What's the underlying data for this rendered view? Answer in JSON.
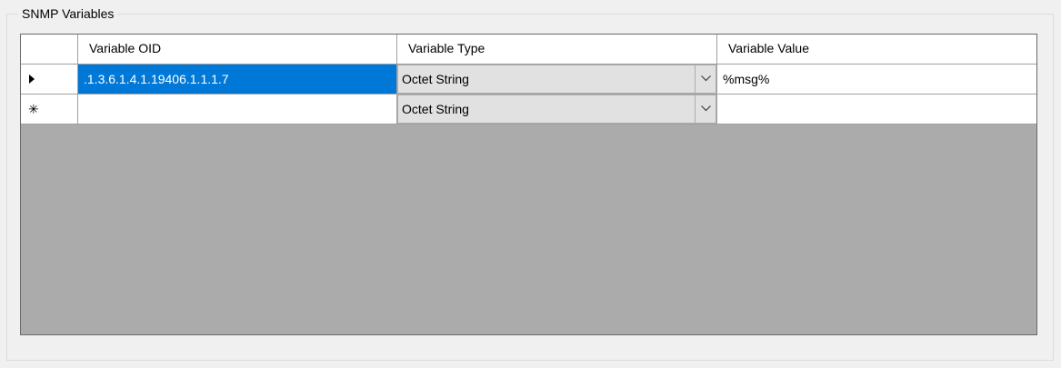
{
  "group": {
    "title": "SNMP Variables"
  },
  "grid": {
    "headers": {
      "oid": "Variable OID",
      "type": "Variable Type",
      "value": "Variable Value"
    },
    "rows": [
      {
        "indicator": "current",
        "oid": ".1.3.6.1.4.1.19406.1.1.1.7",
        "type": "Octet String",
        "value": "%msg%",
        "selected_cell": "oid"
      },
      {
        "indicator": "new",
        "indicator_glyph": "✳",
        "oid": "",
        "type": "Octet String",
        "value": ""
      }
    ]
  },
  "icons": {
    "current_row": "triangle-right-icon",
    "new_row": "asterisk-icon",
    "dropdown": "chevron-down-icon"
  },
  "colors": {
    "selection": "#0078d7",
    "empty_area": "#ababab",
    "combo_background": "#e1e1e1"
  }
}
